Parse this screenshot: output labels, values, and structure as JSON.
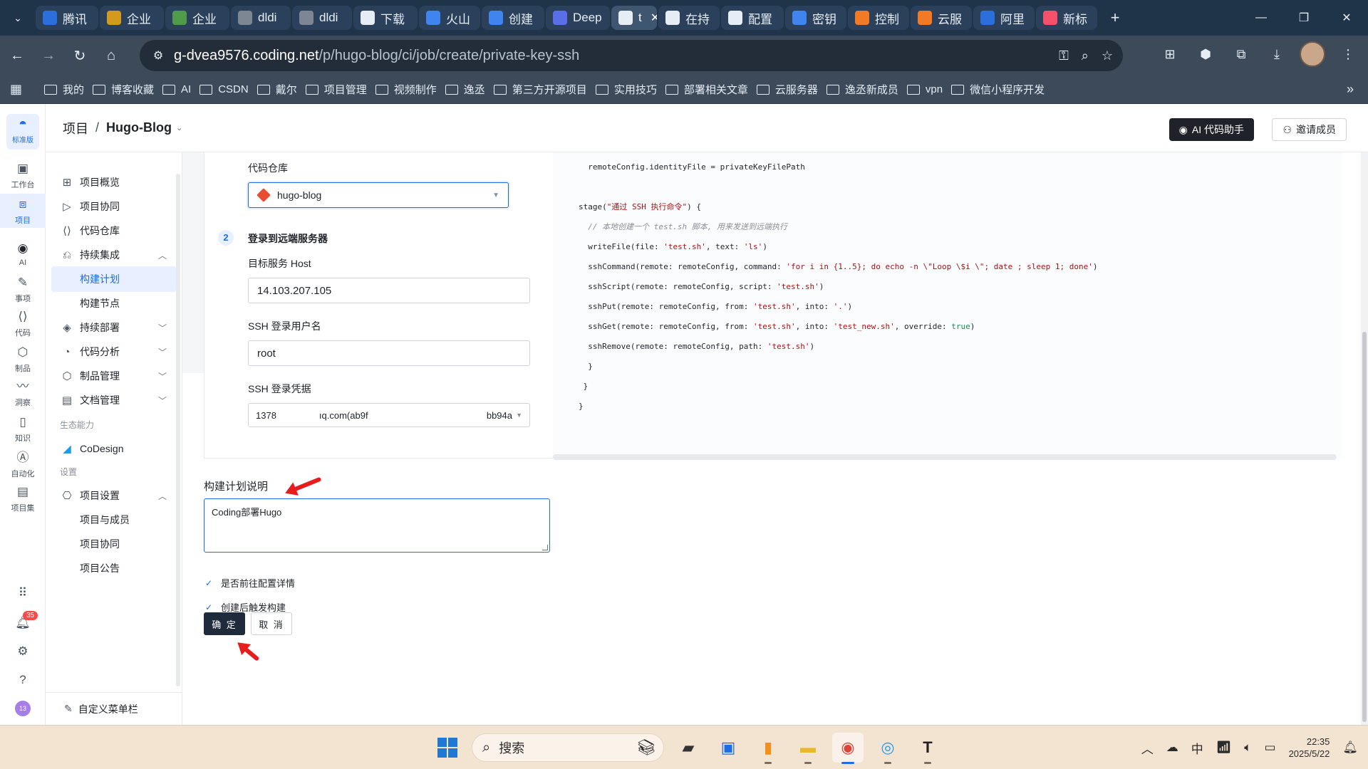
{
  "browser": {
    "tabs": [
      {
        "label": "腾讯",
        "color": "#2a6fdc",
        "icon": "baidu-paw-icon"
      },
      {
        "label": "企业",
        "color": "#d29a1e",
        "icon": "enterprise-icon"
      },
      {
        "label": "企业",
        "color": "#4f9b4a",
        "icon": "enterprise-icon"
      },
      {
        "label": "dldi",
        "color": "#7d8794",
        "icon": "globe-icon"
      },
      {
        "label": "dldi",
        "color": "#7d8794",
        "icon": "globe-icon"
      },
      {
        "label": "下载",
        "color": "#e6edf5",
        "icon": "download-icon"
      },
      {
        "label": "火山",
        "color": "#3f84ef",
        "icon": "volcano-icon"
      },
      {
        "label": "创建",
        "color": "#3f84ef",
        "icon": "volcano-icon"
      },
      {
        "label": "Deep",
        "color": "#5a6ee8",
        "icon": "deepseek-icon"
      },
      {
        "label": "t",
        "color": "#e6edf5",
        "icon": "coding-icon",
        "active": true
      },
      {
        "label": "在持",
        "color": "#e6edf5",
        "icon": "coding-icon"
      },
      {
        "label": "配置",
        "color": "#e6edf5",
        "icon": "coding-icon"
      },
      {
        "label": "密钥",
        "color": "#3f84ef",
        "icon": "volcano-icon"
      },
      {
        "label": "控制",
        "color": "#f27a24",
        "icon": "aliyun-icon"
      },
      {
        "label": "云服",
        "color": "#f27a24",
        "icon": "aliyun-icon"
      },
      {
        "label": "阿里",
        "color": "#2a6fdc",
        "icon": "baidu-paw-icon"
      },
      {
        "label": "新标",
        "color": "#f4506a",
        "icon": "newtab-icon"
      }
    ],
    "url_host": "g-dvea9576.coding.net",
    "url_path": "/p/hugo-blog/ci/job/create/private-key-ssh",
    "bookmarks": [
      "我的",
      "博客收藏",
      "AI",
      "CSDN",
      "戴尔",
      "项目管理",
      "视频制作",
      "逸丞",
      "第三方开源项目",
      "实用技巧",
      "部署相关文章",
      "云服务器",
      "逸丞新成员",
      "vpn",
      "微信小程序开发"
    ]
  },
  "rail": {
    "logo_label": "标准版",
    "items": [
      "工作台",
      "项目",
      "AI",
      "事项",
      "代码",
      "制品",
      "洞察",
      "知识",
      "自动化",
      "项目集"
    ],
    "notification_count": "35",
    "avatar_text": "13"
  },
  "header": {
    "crumb_root": "项目",
    "crumb_sep": "/",
    "project": "Hugo-Blog",
    "ai_button": "AI 代码助手",
    "invite_button": "邀请成员"
  },
  "sidenav": {
    "items": [
      "项目概览",
      "项目协同",
      "代码仓库",
      "持续集成",
      "构建计划",
      "构建节点",
      "持续部署",
      "代码分析",
      "制品管理",
      "文档管理"
    ],
    "eco_group": "生态能力",
    "codesign": "CoDesign",
    "settings_group": "设置",
    "settings": "项目设置",
    "settings_sub": [
      "项目与成员",
      "项目协同",
      "项目公告"
    ],
    "customize": "自定义菜单栏"
  },
  "form": {
    "repo_label": "代码仓库",
    "repo_value": "hugo-blog",
    "step_number": "2",
    "step_title": "登录到远端服务器",
    "host_label": "目标服务 Host",
    "host_value": "14.103.207.105",
    "user_label": "SSH 登录用户名",
    "user_value": "root",
    "cred_label": "SSH 登录凭据",
    "cred_part1": "1378",
    "cred_part2": "ıq.com(ab9f",
    "cred_part3": "bb94a",
    "desc_label": "构建计划说明",
    "desc_value": "Coding部署Hugo",
    "check1": "是否前往配置详情",
    "check2": "创建后触发构建",
    "ok_button": "确 定",
    "cancel_button": "取 消"
  },
  "code": {
    "l1": "  remoteConfig.identityFile = privateKeyFilePath",
    "l2a": "stage(",
    "l2b": "\"通过 SSH 执行命令\"",
    "l2c": ") {",
    "l3": "  // 本地创建一个 test.sh 脚本, 用来发送到远端执行",
    "l4a": "  writeFile(file: ",
    "l4b": "'test.sh'",
    "l4c": ", text: ",
    "l4d": "'ls'",
    "l4e": ")",
    "l5a": "  sshCommand(remote: remoteConfig, command: ",
    "l5b": "'for i in {1..5}; do echo -n \\\"Loop \\$i \\\"; date ; sleep 1; done'",
    "l5c": ")",
    "l6a": "  sshScript(remote: remoteConfig, script: ",
    "l6b": "'test.sh'",
    "l6c": ")",
    "l7a": "  sshPut(remote: remoteConfig, from: ",
    "l7b": "'test.sh'",
    "l7c": ", into: ",
    "l7d": "'.'",
    "l7e": ")",
    "l8a": "  sshGet(remote: remoteConfig, from: ",
    "l8b": "'test.sh'",
    "l8c": ", into: ",
    "l8d": "'test_new.sh'",
    "l8e": ", override: ",
    "l8f": "true",
    "l8g": ")",
    "l9a": "  sshRemove(remote: remoteConfig, path: ",
    "l9b": "'test.sh'",
    "l9c": ")",
    "l10": "  }",
    "l11": " }",
    "l12": "}"
  },
  "taskbar": {
    "search": "搜索",
    "ime": "中",
    "time": "22:35",
    "date": "2025/5/22"
  },
  "colors": {
    "accent": "#1e6be8",
    "tabbar": "#1f3349",
    "toolbar": "#3c4a5a",
    "annotation_arrow": "#e81c1c",
    "primary_button": "#1f2a3c"
  }
}
